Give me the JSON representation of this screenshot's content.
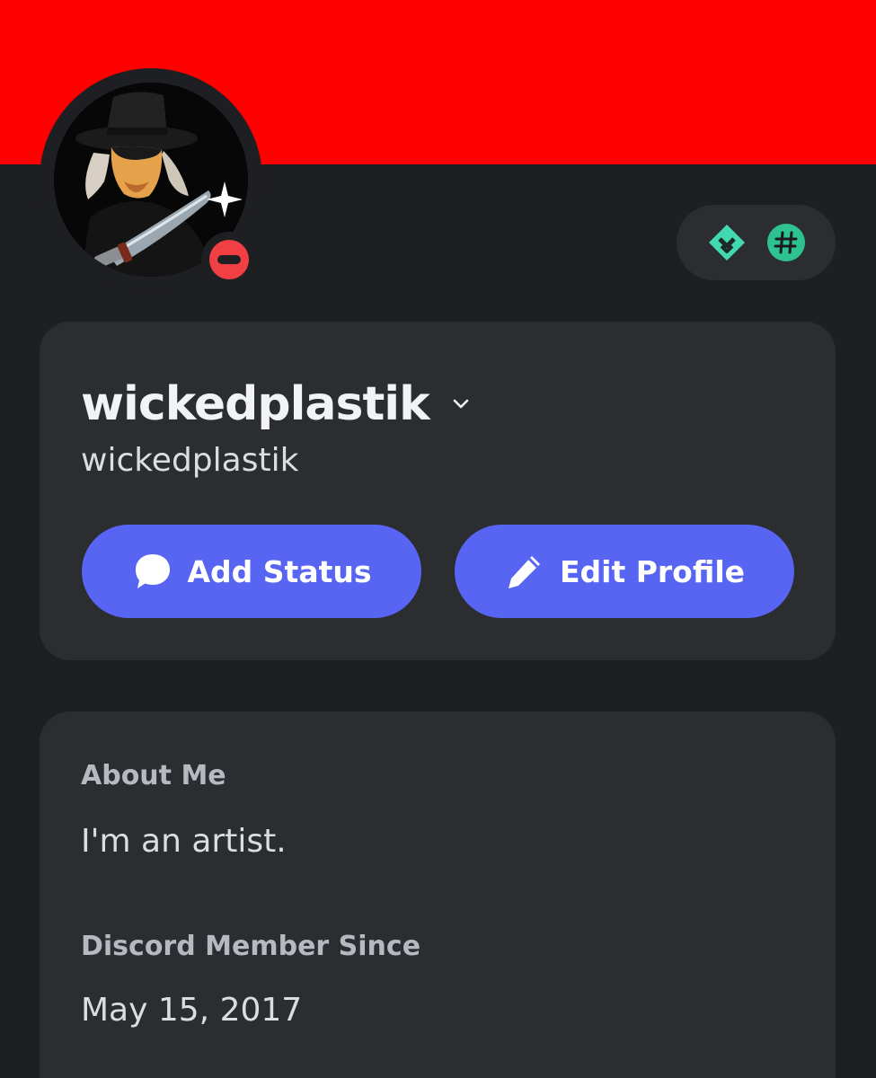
{
  "colors": {
    "banner": "#ff0000",
    "background": "#1e1f22",
    "card": "#2b2d31",
    "button": "#5865f2",
    "status_dnd": "#f23f43",
    "badge_accent": "#23a55a"
  },
  "profile": {
    "display_name": "wickedplastik",
    "username": "wickedplastik",
    "status": "do-not-disturb",
    "avatar_icon": "avatar-image"
  },
  "badges": [
    {
      "icon": "hypesquad-diamond-icon"
    },
    {
      "icon": "hashtag-icon"
    }
  ],
  "actions": {
    "add_status_label": "Add Status",
    "add_status_icon": "speech-bubble-icon",
    "edit_profile_label": "Edit Profile",
    "edit_profile_icon": "pencil-icon"
  },
  "about": {
    "heading": "About Me",
    "text": "I'm an artist."
  },
  "member_since": {
    "heading": "Discord Member Since",
    "date": "May 15, 2017"
  }
}
